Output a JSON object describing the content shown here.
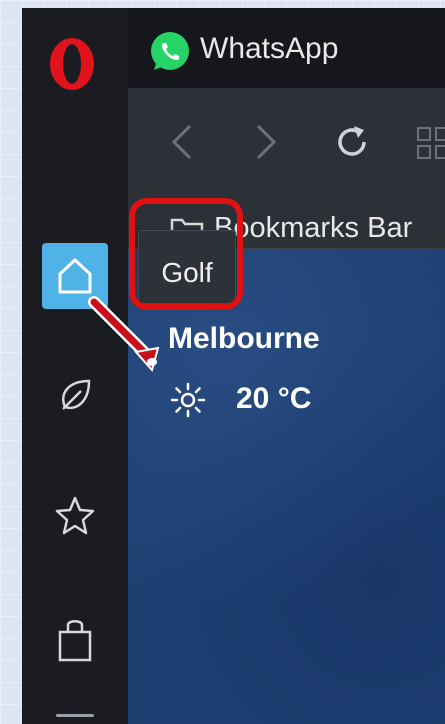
{
  "browser": {
    "tab": {
      "title": "WhatsApp",
      "icon": "whatsapp-icon"
    },
    "logo": "opera-logo-icon"
  },
  "sidebar": {
    "items": [
      {
        "name": "home",
        "icon": "home-icon",
        "active": true
      },
      {
        "name": "leaf",
        "icon": "leaf-icon"
      },
      {
        "name": "favorites",
        "icon": "star-icon"
      },
      {
        "name": "shopping",
        "icon": "shopping-bag-icon"
      }
    ]
  },
  "toolbar": {
    "buttons": [
      "back-icon",
      "forward-icon",
      "reload-icon",
      "grid-icon"
    ]
  },
  "bookmarks": {
    "label": "Bookmarks Bar"
  },
  "tooltip": {
    "label": "Golf"
  },
  "weather": {
    "city": "Melbourne",
    "temperature": "20 °C",
    "icon": "sun-icon"
  },
  "colors": {
    "accent": "#4fb3e8",
    "highlight": "#e01111",
    "opera_red": "#e0121b",
    "whatsapp_green": "#25d366",
    "content_bg": "#1e3f72"
  }
}
